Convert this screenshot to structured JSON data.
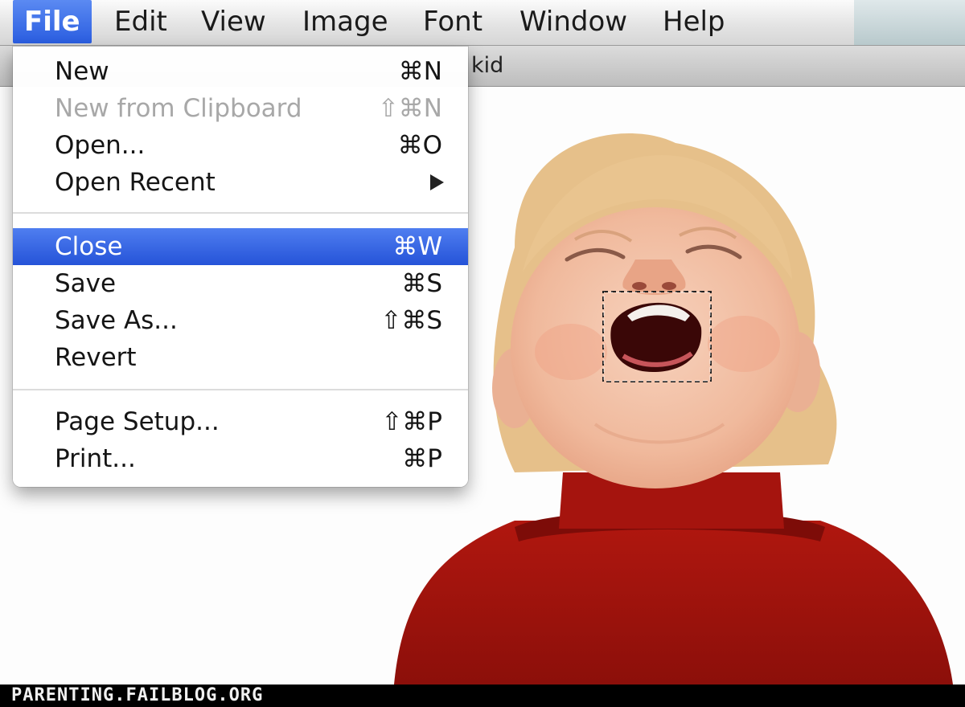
{
  "menubar": {
    "items": [
      {
        "label": "File",
        "active": true
      },
      {
        "label": "Edit"
      },
      {
        "label": "View"
      },
      {
        "label": "Image"
      },
      {
        "label": "Font"
      },
      {
        "label": "Window"
      },
      {
        "label": "Help"
      }
    ]
  },
  "window": {
    "title_fragment": "kid"
  },
  "file_menu": {
    "items": [
      {
        "label": "New",
        "shortcut": "⌘N"
      },
      {
        "label": "New from Clipboard",
        "shortcut": "⇧⌘N",
        "disabled": true
      },
      {
        "label": "Open...",
        "shortcut": "⌘O"
      },
      {
        "label": "Open Recent",
        "submenu": true
      },
      {
        "label": "Close",
        "shortcut": "⌘W",
        "highlighted": true
      },
      {
        "label": "Save",
        "shortcut": "⌘S"
      },
      {
        "label": "Save As...",
        "shortcut": "⇧⌘S"
      },
      {
        "label": "Revert",
        "shortcut": ""
      },
      {
        "label": "Page Setup...",
        "shortcut": "⇧⌘P"
      },
      {
        "label": "Print...",
        "shortcut": "⌘P"
      }
    ]
  },
  "footer": {
    "watermark": "PARENTING.FAILBLOG.ORG"
  },
  "colors": {
    "highlight": "#2f62e3",
    "sweater": "#a8140f",
    "hair": "#e0b67c",
    "skin": "#f2c0a4"
  }
}
